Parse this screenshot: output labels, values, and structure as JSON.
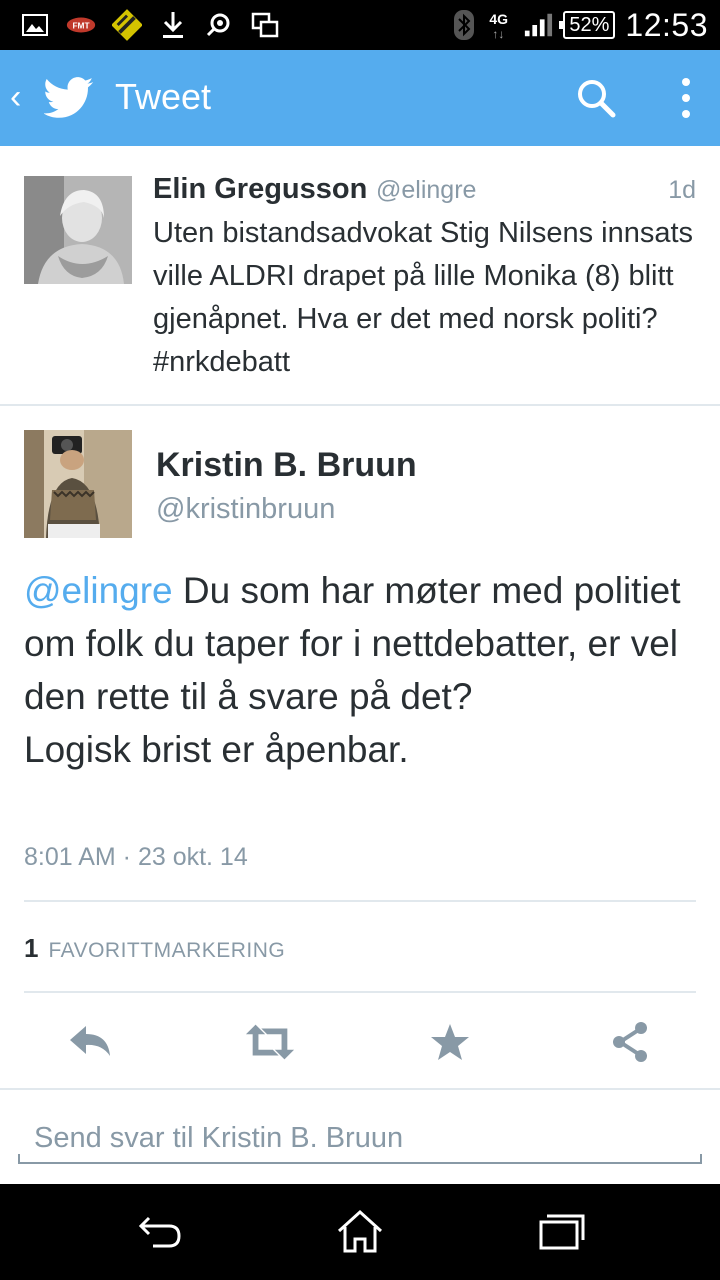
{
  "status_bar": {
    "time": "12:53",
    "battery": "52%",
    "network": "4G",
    "network_arrows": "↑↓",
    "notification_icons": [
      "gallery-icon",
      "fmt-icon",
      "app-icon",
      "download-icon",
      "sync-icon",
      "screens-icon"
    ]
  },
  "app_bar": {
    "title": "Tweet",
    "color": "#55acee"
  },
  "parent_tweet": {
    "name": "Elin Gregusson",
    "handle": "@elingre",
    "time": "1d",
    "text": "Uten bistandsadvokat Stig Nilsens innsats ville ALDRI drapet på lille Monika (8) blitt gjenåpnet. Hva er det med norsk politi? #nrkdebatt"
  },
  "focused_tweet": {
    "name": "Kristin B. Bruun",
    "handle": "@kristinbruun",
    "mention": "@elingre",
    "text_after_mention": " Du som har møter med politiet om folk du taper for i nettdebatter, er vel den rette til å svare på det?",
    "text_line2": "Logisk brist er åpenbar.",
    "timestamp": "8:01 AM · 23 okt. 14",
    "favorites_count": "1",
    "favorites_label": "FAVORITTMARKERING"
  },
  "actions": [
    "reply-icon",
    "retweet-icon",
    "favorite-icon",
    "share-icon"
  ],
  "reply": {
    "placeholder": "Send svar til Kristin B. Bruun"
  },
  "colors": {
    "accent": "#55acee",
    "text": "#292f33",
    "secondary": "#8899a6",
    "action_icon": "#8899a6"
  }
}
